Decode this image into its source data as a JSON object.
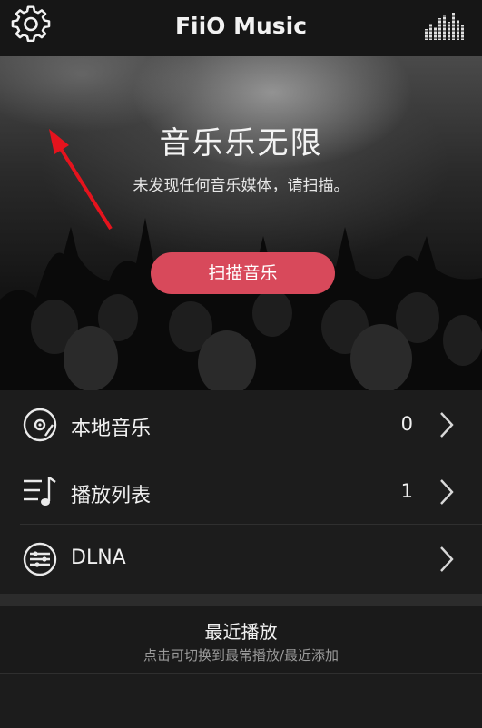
{
  "header": {
    "title": "FiiO Music",
    "left_icon": "gear-icon",
    "right_icon": "equalizer-icon"
  },
  "hero": {
    "title": "音乐乐无限",
    "subtitle": "未发现任何音乐媒体，请扫描。",
    "scan_button": "扫描音乐",
    "accent_color": "#d8495b"
  },
  "menu": [
    {
      "label": "本地音乐",
      "count": "0",
      "icon": "vinyl-disc-icon"
    },
    {
      "label": "播放列表",
      "count": "1",
      "icon": "playlist-icon"
    },
    {
      "label": "DLNA",
      "count": "",
      "icon": "dlna-icon"
    }
  ],
  "recent": {
    "title": "最近播放",
    "subtitle": "点击可切换到最常播放/最近添加"
  }
}
